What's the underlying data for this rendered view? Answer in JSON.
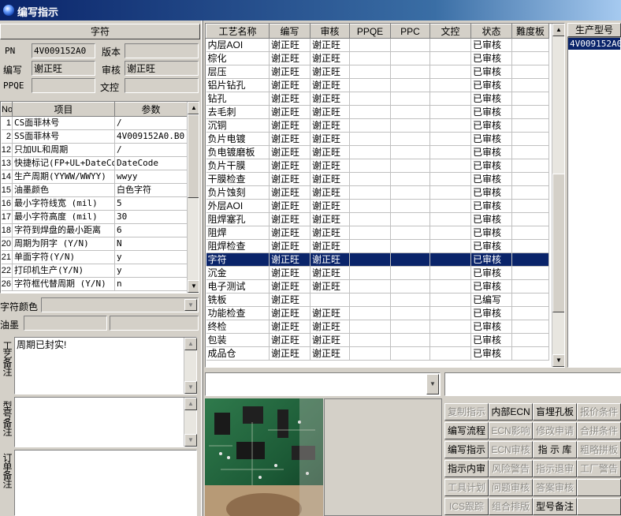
{
  "window": {
    "title": "编写指示"
  },
  "info": {
    "section_title": "字符",
    "pn_label": "PN",
    "pn_value": "4V009152A0",
    "version_label": "版本",
    "version_value": "",
    "writer_label": "编写",
    "writer_value": "谢正旺",
    "reviewer_label": "审核",
    "reviewer_value": "谢正旺",
    "ppqe_label": "PPQE",
    "ppqe_value": "",
    "doc_control_label": "文控",
    "doc_control_value": ""
  },
  "params": {
    "headers": [
      "No",
      "项目",
      "参数"
    ],
    "rows": [
      [
        "1",
        "CS面菲林号",
        "/"
      ],
      [
        "2",
        "SS面菲林号",
        "4V009152A0.B0"
      ],
      [
        "12",
        "只加UL和周期",
        "/"
      ],
      [
        "13",
        "快捷标记(FP+UL+DateCo",
        "DateCode"
      ],
      [
        "14",
        "生产周期(YYWW/WWYY)",
        "wwyy"
      ],
      [
        "15",
        "油墨颜色",
        "白色字符"
      ],
      [
        "16",
        "最小字符线宽 (mil)",
        "5"
      ],
      [
        "17",
        "最小字符高度 (mil)",
        "30"
      ],
      [
        "18",
        "字符到焊盘的最小距离",
        "6"
      ],
      [
        "20",
        "周期为阴字 (Y/N)",
        "N"
      ],
      [
        "21",
        "单面字符(Y/N)",
        "y"
      ],
      [
        "22",
        "打印机生产(Y/N)",
        "y"
      ],
      [
        "26",
        "字符框代替周期 (Y/N)",
        "n"
      ]
    ]
  },
  "char_color": {
    "label": "字符颜色",
    "value": ""
  },
  "ink": {
    "label": "油墨",
    "value1": "",
    "value2": ""
  },
  "notes": {
    "process_label": "工艺备注",
    "process_text": "周期已封实!",
    "model_label": "型号备注",
    "model_text": "",
    "order_label": "订单备注",
    "order_text": ""
  },
  "process_table": {
    "headers": [
      "工艺名称",
      "编写",
      "审核",
      "PPQE",
      "PPC",
      "文控",
      "状态",
      "難度板"
    ],
    "selected_index": 16,
    "rows": [
      [
        "内层AOI",
        "谢正旺",
        "谢正旺",
        "",
        "",
        "",
        "已审核",
        ""
      ],
      [
        "棕化",
        "谢正旺",
        "谢正旺",
        "",
        "",
        "",
        "已审核",
        ""
      ],
      [
        "层压",
        "谢正旺",
        "谢正旺",
        "",
        "",
        "",
        "已审核",
        ""
      ],
      [
        "铝片钻孔",
        "谢正旺",
        "谢正旺",
        "",
        "",
        "",
        "已审核",
        ""
      ],
      [
        "钻孔",
        "谢正旺",
        "谢正旺",
        "",
        "",
        "",
        "已审核",
        ""
      ],
      [
        "去毛刺",
        "谢正旺",
        "谢正旺",
        "",
        "",
        "",
        "已审核",
        ""
      ],
      [
        "沉铜",
        "谢正旺",
        "谢正旺",
        "",
        "",
        "",
        "已审核",
        ""
      ],
      [
        "负片电镀",
        "谢正旺",
        "谢正旺",
        "",
        "",
        "",
        "已审核",
        ""
      ],
      [
        "负电镀磨板",
        "谢正旺",
        "谢正旺",
        "",
        "",
        "",
        "已审核",
        ""
      ],
      [
        "负片干膜",
        "谢正旺",
        "谢正旺",
        "",
        "",
        "",
        "已审核",
        ""
      ],
      [
        "干膜检查",
        "谢正旺",
        "谢正旺",
        "",
        "",
        "",
        "已审核",
        ""
      ],
      [
        "负片蚀刻",
        "谢正旺",
        "谢正旺",
        "",
        "",
        "",
        "已审核",
        ""
      ],
      [
        "外层AOI",
        "谢正旺",
        "谢正旺",
        "",
        "",
        "",
        "已审核",
        ""
      ],
      [
        "阻焊塞孔",
        "谢正旺",
        "谢正旺",
        "",
        "",
        "",
        "已审核",
        ""
      ],
      [
        "阻焊",
        "谢正旺",
        "谢正旺",
        "",
        "",
        "",
        "已审核",
        ""
      ],
      [
        "阻焊检查",
        "谢正旺",
        "谢正旺",
        "",
        "",
        "",
        "已审核",
        ""
      ],
      [
        "字符",
        "谢正旺",
        "谢正旺",
        "",
        "",
        "",
        "已审核",
        ""
      ],
      [
        "沉金",
        "谢正旺",
        "谢正旺",
        "",
        "",
        "",
        "已审核",
        ""
      ],
      [
        "电子测试",
        "谢正旺",
        "谢正旺",
        "",
        "",
        "",
        "已审核",
        ""
      ],
      [
        "铣板",
        "谢正旺",
        "",
        "",
        "",
        "",
        "已编写",
        ""
      ],
      [
        "功能检查",
        "谢正旺",
        "谢正旺",
        "",
        "",
        "",
        "已审核",
        ""
      ],
      [
        "终检",
        "谢正旺",
        "谢正旺",
        "",
        "",
        "",
        "已审核",
        ""
      ],
      [
        "包装",
        "谢正旺",
        "谢正旺",
        "",
        "",
        "",
        "已审核",
        ""
      ],
      [
        "成品仓",
        "谢正旺",
        "谢正旺",
        "",
        "",
        "",
        "已审核",
        ""
      ]
    ]
  },
  "model_list": {
    "header": "生产型号",
    "items": [
      "4V009152A0"
    ]
  },
  "buttons": [
    [
      {
        "label": "复制指示",
        "enabled": false
      },
      {
        "label": "内部ECN",
        "enabled": true
      },
      {
        "label": "盲埋孔板",
        "enabled": true
      },
      {
        "label": "报价条件",
        "enabled": false
      }
    ],
    [
      {
        "label": "编写流程",
        "enabled": true
      },
      {
        "label": "ECN影响",
        "enabled": false
      },
      {
        "label": "修改申请",
        "enabled": false
      },
      {
        "label": "合拼条件",
        "enabled": false
      }
    ],
    [
      {
        "label": "编写指示",
        "enabled": true
      },
      {
        "label": "ECN审核",
        "enabled": false
      },
      {
        "label": "指 示 库",
        "enabled": true
      },
      {
        "label": "粗略拼板",
        "enabled": false
      }
    ],
    [
      {
        "label": "指示内审",
        "enabled": true
      },
      {
        "label": "风险警告",
        "enabled": false
      },
      {
        "label": "指示退审",
        "enabled": false
      },
      {
        "label": "工厂警告",
        "enabled": false
      }
    ],
    [
      {
        "label": "工具计划",
        "enabled": false
      },
      {
        "label": "问题审核",
        "enabled": false
      },
      {
        "label": "答案审核",
        "enabled": false
      },
      {
        "label": "",
        "enabled": false
      }
    ],
    [
      {
        "label": "ICS跟踪",
        "enabled": false
      },
      {
        "label": "组合排版",
        "enabled": false
      },
      {
        "label": "型号备注",
        "enabled": true
      },
      {
        "label": "",
        "enabled": false
      }
    ]
  ],
  "colors": {
    "selection": "#0a246a",
    "face": "#d4d0c8",
    "title_start": "#0a246a",
    "title_end": "#a6caf0"
  }
}
